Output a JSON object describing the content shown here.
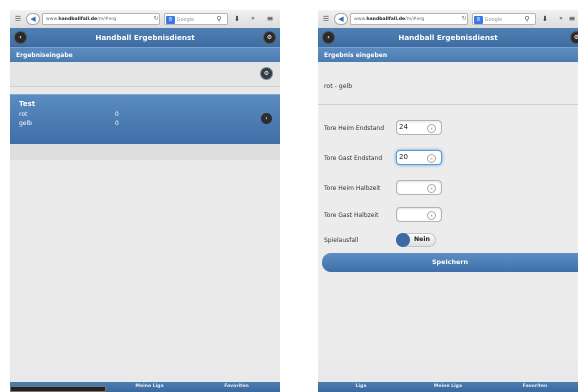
{
  "browser": {
    "url_prefix": "www.",
    "url_domain": "handballfall.de",
    "url_rest": "/m/#erg",
    "search_engine": "Google"
  },
  "left": {
    "header_title": "Handball Ergebnisdienst",
    "subheader": "Ergebniseingabe",
    "game": {
      "title": "Test",
      "home_team": "rot",
      "home_score": "0",
      "away_team": "gelb",
      "away_score": "0"
    },
    "nav": [
      "Meine Liga",
      "Favoriten"
    ]
  },
  "right": {
    "header_title": "Handball Ergebnisdienst",
    "subheader": "Ergebnis eingeben",
    "match": "rot - gelb",
    "fields": [
      {
        "label": "Tore Heim Endstand",
        "value": "24"
      },
      {
        "label": "Tore Gast Endstand",
        "value": "20"
      },
      {
        "label": "Tore Heim Halbzeit",
        "value": ""
      },
      {
        "label": "Tore Gast Halbzeit",
        "value": ""
      }
    ],
    "spielausfall_label": "Spielausfall",
    "spielausfall_value": "Nein",
    "save_label": "Speichern",
    "nav": [
      "Liga",
      "Meine Liga",
      "Favoriten"
    ]
  },
  "colors": {
    "header": "#4f7fb3",
    "card": "#4a7bb1",
    "background": "#e9e9e9"
  },
  "icons": [
    "menu-icon",
    "back-arrow-icon",
    "reload-icon",
    "search-icon",
    "download-icon",
    "overflow-icon",
    "hamburger-icon",
    "settings-icon",
    "chevron-right-icon",
    "clear-icon"
  ]
}
